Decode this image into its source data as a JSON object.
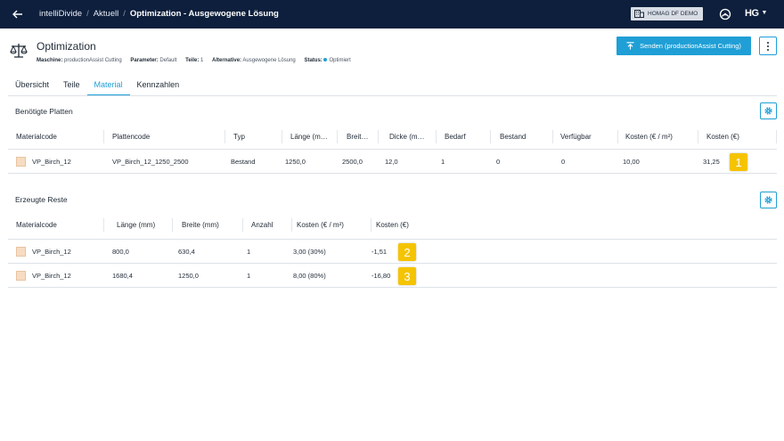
{
  "topbar": {
    "breadcrumb": [
      "intelliDivide",
      "Aktuell"
    ],
    "separator": "/",
    "current": "Optimization - Ausgewogene Lösung",
    "demo_label": "HOMAG DF DEMO",
    "user_initials": "HG"
  },
  "header": {
    "title": "Optimization",
    "meta": [
      {
        "label": "Maschine:",
        "value": "productionAssist Cutting"
      },
      {
        "label": "Parameter:",
        "value": "Default"
      },
      {
        "label": "Teile:",
        "value": "1"
      },
      {
        "label": "Alternative:",
        "value": "Ausgewogene Lösung"
      },
      {
        "label": "Status:",
        "value": "Optimiert"
      }
    ],
    "send_label": "Senden (productionAssist Cutting)"
  },
  "tabs": [
    "Übersicht",
    "Teile",
    "Material",
    "Kennzahlen"
  ],
  "active_tab": "Material",
  "plates": {
    "title": "Benötigte Platten",
    "columns": [
      "Materialcode",
      "Plattencode",
      "Typ",
      "Länge (m…",
      "Breit…",
      "Dicke (m…",
      "Bedarf",
      "Bestand",
      "Verfügbar",
      "Kosten (€ / m²)",
      "Kosten (€)"
    ],
    "rows": [
      {
        "material": "VP_Birch_12",
        "code": "VP_Birch_12_1250_2500",
        "typ": "Bestand",
        "laenge": "1250,0",
        "breite": "2500,0",
        "dicke": "12,0",
        "bedarf": "1",
        "bestand": "0",
        "verfuegbar": "0",
        "kosten_m2": "10,00",
        "kosten": "31,25",
        "marker": "1"
      }
    ]
  },
  "remnants": {
    "title": "Erzeugte Reste",
    "columns": [
      "Materialcode",
      "Länge (mm)",
      "Breite (mm)",
      "Anzahl",
      "Kosten (€ / m²)",
      "Kosten (€)"
    ],
    "rows": [
      {
        "material": "VP_Birch_12",
        "laenge": "800,0",
        "breite": "630,4",
        "anzahl": "1",
        "kosten_m2": "3,00 (30%)",
        "kosten": "-1,51",
        "marker": "2"
      },
      {
        "material": "VP_Birch_12",
        "laenge": "1680,4",
        "breite": "1250,0",
        "anzahl": "1",
        "kosten_m2": "8,00 (80%)",
        "kosten": "-16,80",
        "marker": "3"
      }
    ]
  },
  "colors": {
    "topbar": "#0d1f3c",
    "accent": "#1f9fd6",
    "marker": "#f5c400",
    "swatch": "#f6dcc2"
  }
}
